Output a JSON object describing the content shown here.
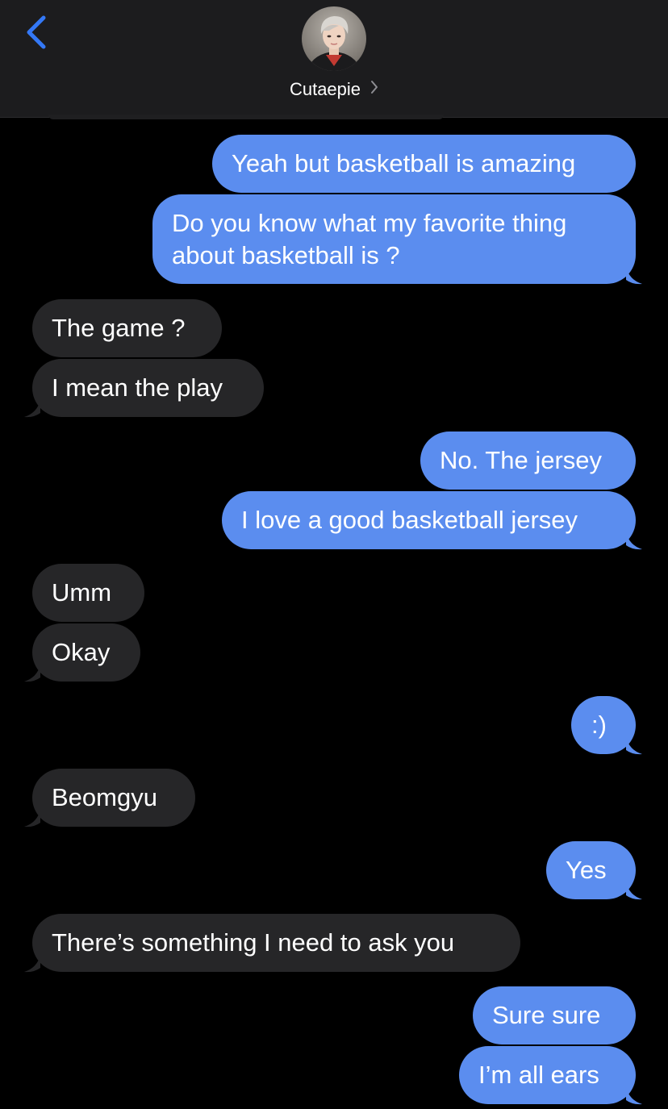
{
  "header": {
    "contact_name": "Cutaepie",
    "colors": {
      "background": "#1c1c1e",
      "back_arrow": "#3478f6",
      "name_text": "#ffffff"
    },
    "icons": {
      "back": "chevron-left-icon",
      "details": "chevron-right-icon"
    }
  },
  "colors": {
    "sent_bubble": "#5b8def",
    "received_bubble": "#262628",
    "background": "#000000"
  },
  "messages": [
    {
      "sender": "me",
      "text": "Yeah but basketball is amazing"
    },
    {
      "sender": "me",
      "text": "Do you know what my favorite thing about basketball is ?"
    },
    {
      "sender": "them",
      "text": "The game ?"
    },
    {
      "sender": "them",
      "text": "I mean the play"
    },
    {
      "sender": "me",
      "text": "No. The jersey"
    },
    {
      "sender": "me",
      "text": "I love a good basketball jersey"
    },
    {
      "sender": "them",
      "text": "Umm"
    },
    {
      "sender": "them",
      "text": "Okay"
    },
    {
      "sender": "me",
      "text": ":)"
    },
    {
      "sender": "them",
      "text": "Beomgyu"
    },
    {
      "sender": "me",
      "text": "Yes"
    },
    {
      "sender": "them",
      "text": "There’s something I need to ask you"
    },
    {
      "sender": "me",
      "text": "Sure sure"
    },
    {
      "sender": "me",
      "text": "I’m all ears"
    }
  ]
}
